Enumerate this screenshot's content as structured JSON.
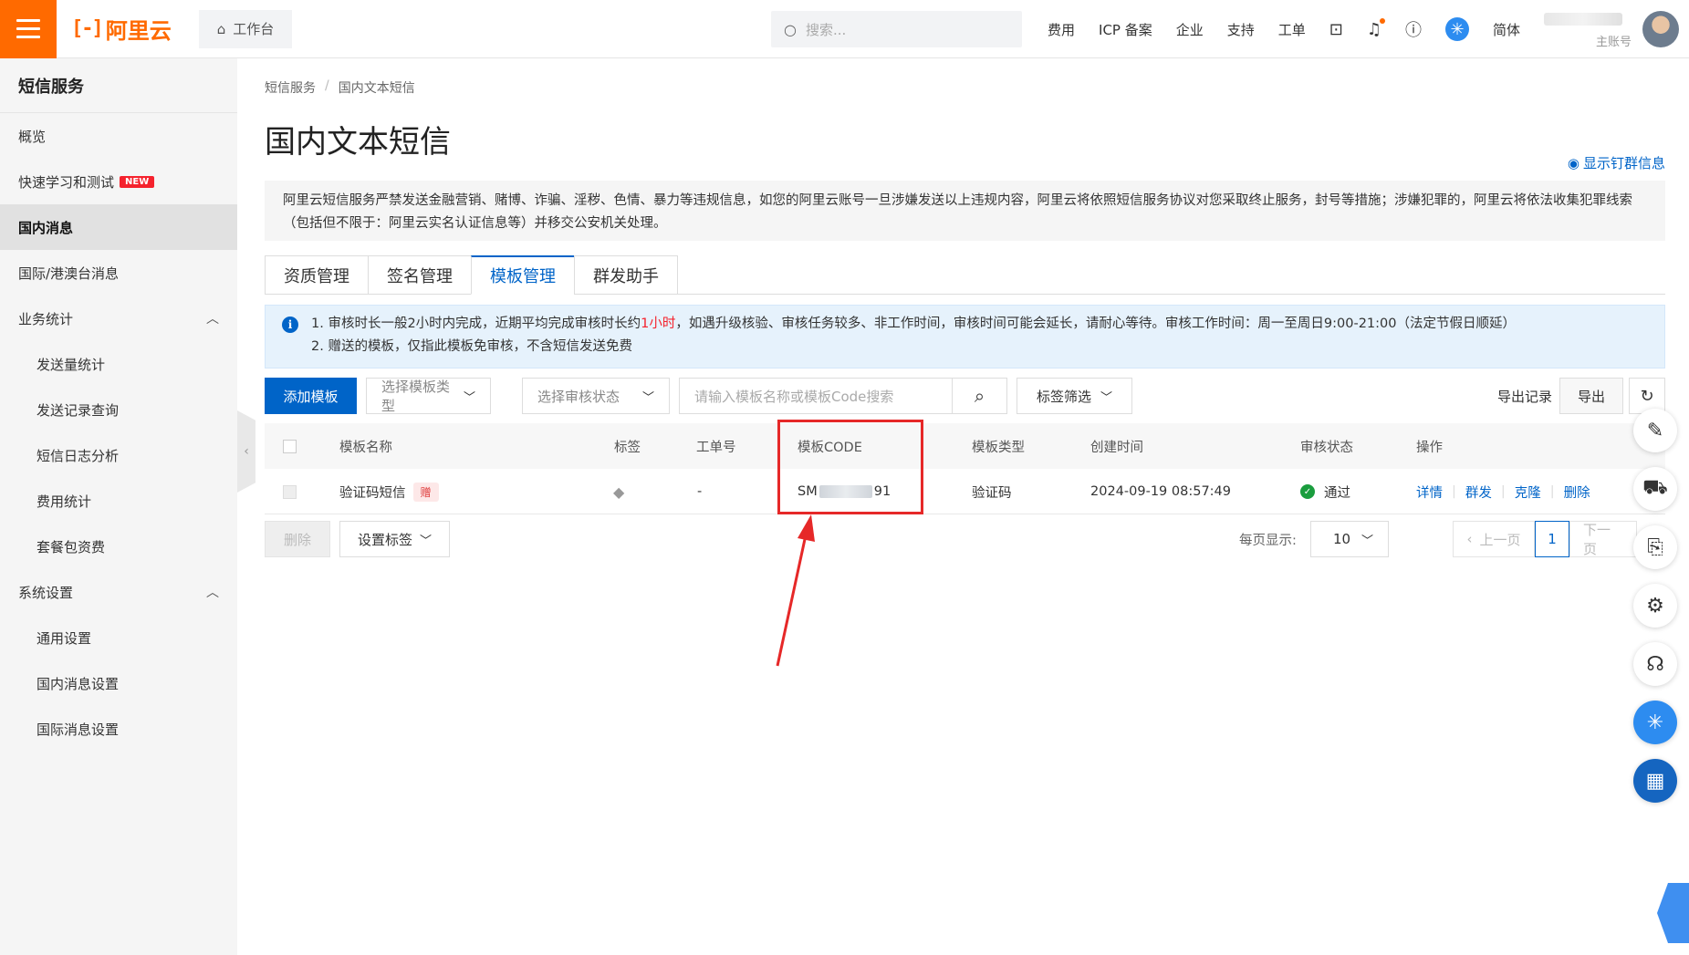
{
  "topbar": {
    "logo_text": "阿里云",
    "workbench": "工作台",
    "search_placeholder": "搜索...",
    "nav": [
      "费用",
      "ICP 备案",
      "企业",
      "支持",
      "工单"
    ],
    "lang": "简体",
    "account_role": "主账号"
  },
  "sidebar": {
    "title": "短信服务",
    "items": [
      {
        "label": "概览"
      },
      {
        "label": "快速学习和测试",
        "badge": "NEW"
      },
      {
        "label": "国内消息"
      },
      {
        "label": "国际/港澳台消息"
      },
      {
        "label": "业务统计"
      },
      {
        "label": "发送量统计"
      },
      {
        "label": "发送记录查询"
      },
      {
        "label": "短信日志分析"
      },
      {
        "label": "费用统计"
      },
      {
        "label": "套餐包资费"
      },
      {
        "label": "系统设置"
      },
      {
        "label": "通用设置"
      },
      {
        "label": "国内消息设置"
      },
      {
        "label": "国际消息设置"
      }
    ]
  },
  "breadcrumb": [
    "短信服务",
    "国内文本短信"
  ],
  "page_title": "国内文本短信",
  "show_group_link": "显示钉群信息",
  "warning_text": "阿里云短信服务严禁发送金融营销、赌博、诈骗、淫秽、色情、暴力等违规信息，如您的阿里云账号一旦涉嫌发送以上违规内容，阿里云将依照短信服务协议对您采取终止服务，封号等措施；涉嫌犯罪的，阿里云将依法收集犯罪线索（包括但不限于：阿里云实名认证信息等）并移交公安机关处理。",
  "tabs": [
    "资质管理",
    "签名管理",
    "模板管理",
    "群发助手"
  ],
  "info": {
    "line1_prefix": "1. 审核时长一般2小时内完成，近期平均完成审核时长约",
    "line1_highlight": "1小时",
    "line1_suffix": "，如遇升级核验、审核任务较多、非工作时间，审核时间可能会延长，请耐心等待。审核工作时间：周一至周日9:00-21:00（法定节假日顺延）",
    "line2": "2. 赠送的模板，仅指此模板免审核，不含短信发送免费"
  },
  "toolbar": {
    "add_template": "添加模板",
    "type_select": "选择模板类型",
    "status_select": "选择审核状态",
    "search_placeholder": "请输入模板名称或模板Code搜索",
    "tag_filter": "标签筛选",
    "export_records": "导出记录",
    "export": "导出"
  },
  "table": {
    "headers": [
      "模板名称",
      "标签",
      "工单号",
      "模板CODE",
      "模板类型",
      "创建时间",
      "审核状态",
      "操作"
    ],
    "rows": [
      {
        "name": "验证码短信",
        "gift_badge": "赠",
        "ticket": "-",
        "code_prefix": "SM",
        "code_suffix": "91",
        "type": "验证码",
        "created": "2024-09-19 08:57:49",
        "status": "通过",
        "ops": [
          "详情",
          "群发",
          "克隆",
          "删除"
        ]
      }
    ]
  },
  "footer": {
    "delete": "删除",
    "set_tag": "设置标签",
    "per_page_label": "每页显示:",
    "per_page_value": "10",
    "prev": "上一页",
    "current_page": "1",
    "next": "下一页"
  },
  "colors": {
    "brand_orange": "#ff6a00",
    "primary_blue": "#0064c8",
    "highlight_red": "#e62828"
  }
}
